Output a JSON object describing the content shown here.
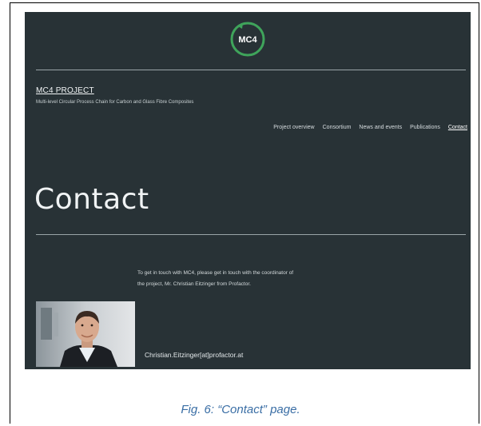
{
  "site": {
    "logo_text": "MC4",
    "project_name": "MC4 PROJECT",
    "project_subtitle": "Multi-level Circular Process Chain for Carbon and Glass Fibre Composites",
    "nav": [
      {
        "label": "Project overview"
      },
      {
        "label": "Consortium"
      },
      {
        "label": "News and events"
      },
      {
        "label": "Publications"
      },
      {
        "label": "Contact",
        "active": true
      }
    ],
    "page_title": "Contact",
    "intro_line1": "To get in touch with MC4, please get in touch with the coordinator of",
    "intro_line2": "the project, Mr. Christian Eitzinger from Profactor.",
    "email": "Christian.Eitzinger[at]profactor.at"
  },
  "caption": "Fig. 6: “Contact” page.",
  "colors": {
    "background": "#283236",
    "logo_green": "#3fa45b",
    "caption": "#3a6ea5"
  }
}
